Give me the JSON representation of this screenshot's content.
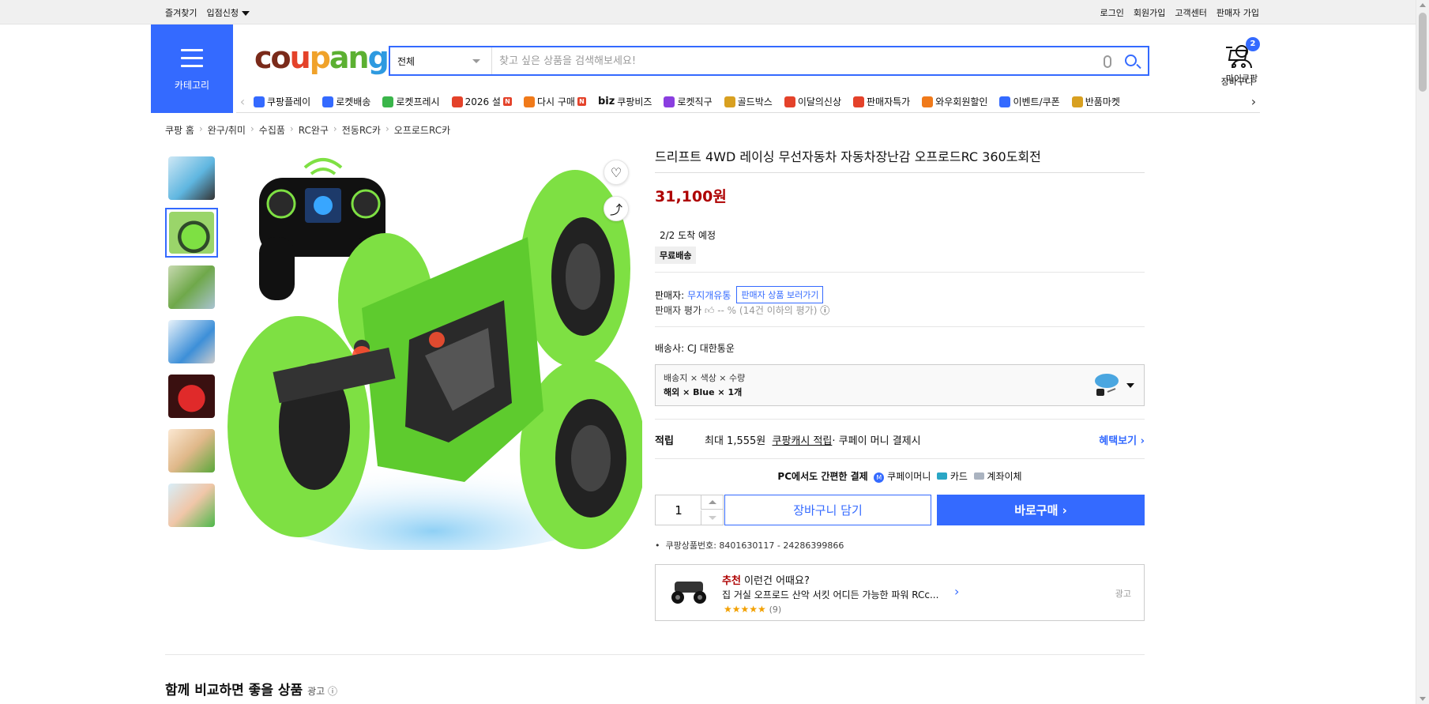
{
  "topbar": {
    "left": [
      "즐겨찾기",
      "입점신청"
    ],
    "right": [
      "로그인",
      "회원가입",
      "고객센터",
      "판매자 가입"
    ]
  },
  "header": {
    "category_label": "카테고리",
    "logo": "coupang",
    "search": {
      "category": "전체",
      "placeholder": "찾고 싶은 상품을 검색해보세요!"
    },
    "my_label": "마이쿠팡",
    "cart_label": "장바구니",
    "cart_count": "2"
  },
  "nav": {
    "items": [
      {
        "label": "쿠팡플레이",
        "color": "#346aff"
      },
      {
        "label": "로켓배송",
        "color": "#346aff"
      },
      {
        "label": "로켓프레시",
        "color": "#3ab54a"
      },
      {
        "label": "2026 설",
        "color": "#e4422a",
        "badge": "N"
      },
      {
        "label": "다시 구매",
        "color": "#f07a1a",
        "badge": "N"
      },
      {
        "label": "쿠팡비즈",
        "prefix": "biz"
      },
      {
        "label": "로켓직구",
        "color": "#8a3ee0"
      },
      {
        "label": "골드박스",
        "color": "#d8a020"
      },
      {
        "label": "이달의신상",
        "color": "#e4422a"
      },
      {
        "label": "판매자특가",
        "color": "#e4422a"
      },
      {
        "label": "와우회원할인",
        "color": "#f07a1a"
      },
      {
        "label": "이벤트/쿠폰",
        "color": "#346aff"
      },
      {
        "label": "반품마켓",
        "color": "#d8a020"
      }
    ]
  },
  "breadcrumb": [
    "쿠팡 홈",
    "완구/취미",
    "수집품",
    "RC완구",
    "전동RC카",
    "오프로드RC카"
  ],
  "product": {
    "title": "드리프트 4WD 레이싱 무선자동차 자동차장난감 오프로드RC 360도회전",
    "price": "31,100원",
    "arrival": "2/2 도착 예정",
    "free_shipping": "무료배송",
    "seller_label": "판매자:",
    "seller_name": "무지개유통",
    "seller_button": "판매자 상품 보러가기",
    "seller_rating_label": "판매자 평가",
    "seller_rating_value": "-- % (14건 이하의 평가)",
    "courier": "배송사:  CJ 대한통운",
    "option_keys": "배송지 × 색상 × 수량",
    "option_values": "해외 × Blue × 1개",
    "reward_label": "적립",
    "reward_text_1": "최대 1,555원",
    "reward_text_2": "쿠팡캐시 적립",
    "reward_text_3": " · 쿠페이 머니 결제시",
    "reward_link": "혜택보기 ›",
    "pay_title": "PC에서도 간편한 결제",
    "pay_options": [
      "쿠페이머니",
      "카드",
      "계좌이체"
    ],
    "quantity": "1",
    "add_to_cart": "장바구니 담기",
    "buy_now": "바로구매 ›",
    "product_id": "쿠팡상품번호: 8401630117 - 24286399866",
    "recommend": {
      "tag": "추천",
      "headline": " 이런건 어때요?",
      "name": "집 거실 오프로드 산악 서킷 어디든 가능한 파워 RCc...",
      "stars": "★★★★★",
      "review_count": "(9)",
      "ad": "광고"
    }
  },
  "section": {
    "title": "함께 비교하면 좋을 상품",
    "ad": "광고 ⓘ"
  }
}
